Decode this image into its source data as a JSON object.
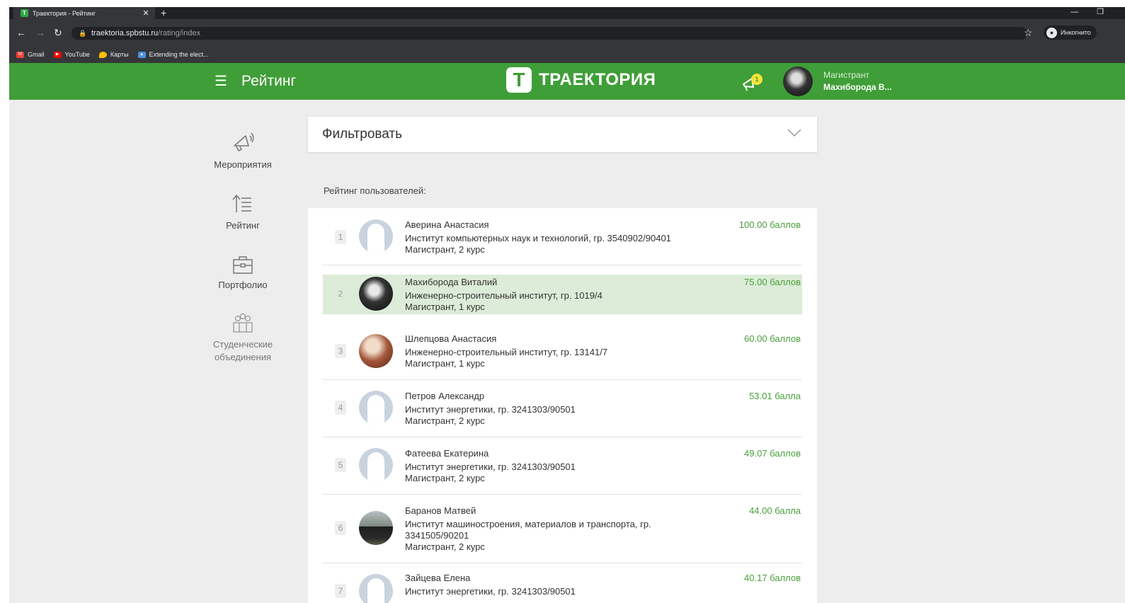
{
  "browser": {
    "tab_title": "Траектория - Рейтинг",
    "tab_close": "✕",
    "new_tab": "+",
    "url_host": "traektoria.spbstu.ru",
    "url_path": "/rating/index",
    "incognito_label": "Инкогнито",
    "bookmarks": [
      {
        "label": "Gmail",
        "color": "#ea4335"
      },
      {
        "label": "YouTube",
        "color": "#ff0000"
      },
      {
        "label": "Карты",
        "color": "#fbbc04"
      },
      {
        "label": "Extending the elect...",
        "color": "#4a90e2"
      }
    ]
  },
  "header": {
    "page_title": "Рейтинг",
    "logo_mark": "T",
    "logo_text": "ТРАЕКТОРИЯ",
    "notification_count": "1",
    "user_role": "Магистрант",
    "user_name": "Махиборода В..."
  },
  "sidebar": {
    "items": [
      {
        "label": "Мероприятия",
        "icon": "megaphone-icon"
      },
      {
        "label": "Рейтинг",
        "icon": "rating-list-icon"
      },
      {
        "label": "Портфолио",
        "icon": "briefcase-icon"
      },
      {
        "label": "Студенческие объединения",
        "icon": "people-group-icon"
      }
    ]
  },
  "filter": {
    "title": "Фильтровать"
  },
  "rating": {
    "label": "Рейтинг пользователей:",
    "rows": [
      {
        "rank": "1",
        "name": "Аверина Анастасия",
        "institute": "Институт компьютерных наук и технологий, гр. 3540902/90401",
        "level": "Магистрант, 2 курс",
        "score": "100.00 баллов",
        "avatar": "placeholder"
      },
      {
        "rank": "2",
        "name": "Махиборода Виталий",
        "institute": "Инженерно-строительный институт, гр. 1019/4",
        "level": "Магистрант, 1 курс",
        "score": "75.00 баллов",
        "avatar": "photo-dark"
      },
      {
        "rank": "3",
        "name": "Шлепцова Анастасия",
        "institute": "Инженерно-строительный институт, гр. 13141/7",
        "level": "Магистрант, 1 курс",
        "score": "60.00 баллов",
        "avatar": "photo-warm"
      },
      {
        "rank": "4",
        "name": "Петров Александр",
        "institute": "Институт энергетики, гр. 3241303/90501",
        "level": "Магистрант, 2 курс",
        "score": "53.01 балла",
        "avatar": "placeholder"
      },
      {
        "rank": "5",
        "name": "Фатеева Екатерина",
        "institute": "Институт энергетики, гр. 3241303/90501",
        "level": "Магистрант, 2 курс",
        "score": "49.07 баллов",
        "avatar": "placeholder"
      },
      {
        "rank": "6",
        "name": "Баранов Матвей",
        "institute": "Институт машиностроения, материалов и транспорта, гр. 3341505/90201",
        "level": "Магистрант, 2 курс",
        "score": "44.00 балла",
        "avatar": "photo-outdoor"
      },
      {
        "rank": "7",
        "name": "Зайцева Елена",
        "institute": "Институт энергетики, гр. 3241303/90501",
        "level": "",
        "score": "40.17 баллов",
        "avatar": "placeholder"
      }
    ]
  },
  "colors": {
    "brand_green": "#3f9e38",
    "score_green": "#4a9f3c",
    "current_row": "#dcecd8"
  }
}
